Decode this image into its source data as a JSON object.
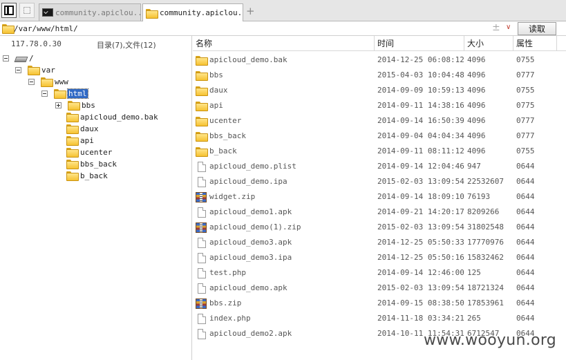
{
  "tabs": [
    {
      "label": "community.apiclou..."
    },
    {
      "label": "community.apiclou..."
    }
  ],
  "tab_add": "+",
  "path": {
    "value": "/var/www/html/",
    "plus": "±",
    "dropdown": "∨",
    "read_label": "读取"
  },
  "left": {
    "ip": "117.78.0.30",
    "count": "目录(7),文件(12)",
    "tree": [
      "/",
      "var",
      "www",
      "html",
      "bbs",
      "apicloud_demo.bak",
      "daux",
      "api",
      "ucenter",
      "bbs_back",
      "b_back"
    ]
  },
  "columns": {
    "name": "名称",
    "time": "时间",
    "size": "大小",
    "attr": "属性"
  },
  "files": [
    {
      "icon": "folder",
      "name": "apicloud_demo.bak",
      "time": "2014-12-25 06:08:12",
      "size": "4096",
      "attr": "0755"
    },
    {
      "icon": "folder",
      "name": "bbs",
      "time": "2015-04-03 10:04:48",
      "size": "4096",
      "attr": "0777"
    },
    {
      "icon": "folder",
      "name": "daux",
      "time": "2014-09-09 10:59:13",
      "size": "4096",
      "attr": "0755"
    },
    {
      "icon": "folder",
      "name": "api",
      "time": "2014-09-11 14:38:16",
      "size": "4096",
      "attr": "0775"
    },
    {
      "icon": "folder",
      "name": "ucenter",
      "time": "2014-09-14 16:50:39",
      "size": "4096",
      "attr": "0777"
    },
    {
      "icon": "folder",
      "name": "bbs_back",
      "time": "2014-09-04 04:04:34",
      "size": "4096",
      "attr": "0777"
    },
    {
      "icon": "folder",
      "name": "b_back",
      "time": "2014-09-11 08:11:12",
      "size": "4096",
      "attr": "0755"
    },
    {
      "icon": "file",
      "name": "apicloud_demo.plist",
      "time": "2014-09-14 12:04:46",
      "size": "947",
      "attr": "0644"
    },
    {
      "icon": "file",
      "name": "apicloud_demo.ipa",
      "time": "2015-02-03 13:09:54",
      "size": "22532607",
      "attr": "0644"
    },
    {
      "icon": "zip",
      "name": "widget.zip",
      "time": "2014-09-14 18:09:10",
      "size": "76193",
      "attr": "0644"
    },
    {
      "icon": "file",
      "name": "apicloud_demo1.apk",
      "time": "2014-09-21 14:20:17",
      "size": "8209266",
      "attr": "0644"
    },
    {
      "icon": "zip",
      "name": "apicloud_demo(1).zip",
      "time": "2015-02-03 13:09:54",
      "size": "31802548",
      "attr": "0644"
    },
    {
      "icon": "file",
      "name": "apicloud_demo3.apk",
      "time": "2014-12-25 05:50:33",
      "size": "17770976",
      "attr": "0644"
    },
    {
      "icon": "file",
      "name": "apicloud_demo3.ipa",
      "time": "2014-12-25 05:50:16",
      "size": "15832462",
      "attr": "0644"
    },
    {
      "icon": "file",
      "name": "test.php",
      "time": "2014-09-14 12:46:00",
      "size": "125",
      "attr": "0644"
    },
    {
      "icon": "file",
      "name": "apicloud_demo.apk",
      "time": "2015-02-03 13:09:54",
      "size": "18721324",
      "attr": "0644"
    },
    {
      "icon": "zip",
      "name": "bbs.zip",
      "time": "2014-09-15 08:38:50",
      "size": "17853961",
      "attr": "0644"
    },
    {
      "icon": "file",
      "name": "index.php",
      "time": "2014-11-18 03:34:21",
      "size": "265",
      "attr": "0644"
    },
    {
      "icon": "file",
      "name": "apicloud_demo2.apk",
      "time": "2014-10-11 11:54:31",
      "size": "6712547",
      "attr": "0644"
    }
  ],
  "watermark": "www.wooyun.org"
}
